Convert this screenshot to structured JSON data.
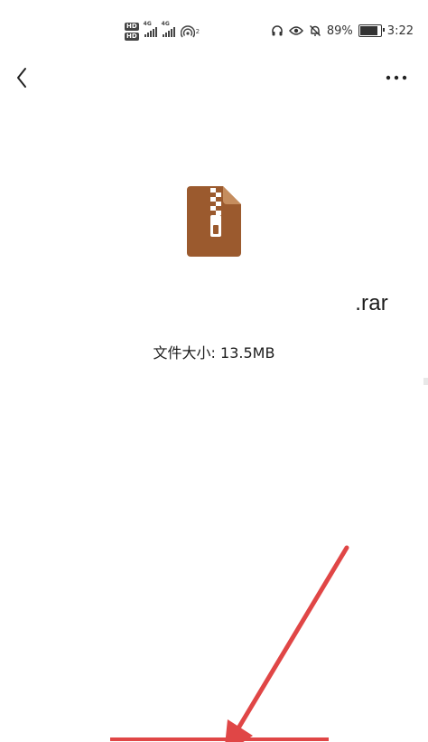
{
  "status_bar": {
    "hd_top": "HD",
    "hd_bottom": "HD",
    "signal_tag_1": "4G",
    "signal_tag_2": "4G",
    "wifi_sup": "2",
    "battery_percent": "89%",
    "battery_level": 0.89,
    "time": "3:22",
    "icons": [
      "headset-icon",
      "eye-icon",
      "mute-bell-icon",
      "battery-icon"
    ]
  },
  "nav": {
    "back_icon": "chevron-left-icon",
    "more_icon": "more-dots-icon"
  },
  "file": {
    "icon": "zip-archive-icon",
    "icon_color": "#9b5a2e",
    "name": ".rar",
    "size_text": "文件大小: 13.5MB"
  },
  "annotation": {
    "arrow_color": "#e04646"
  }
}
